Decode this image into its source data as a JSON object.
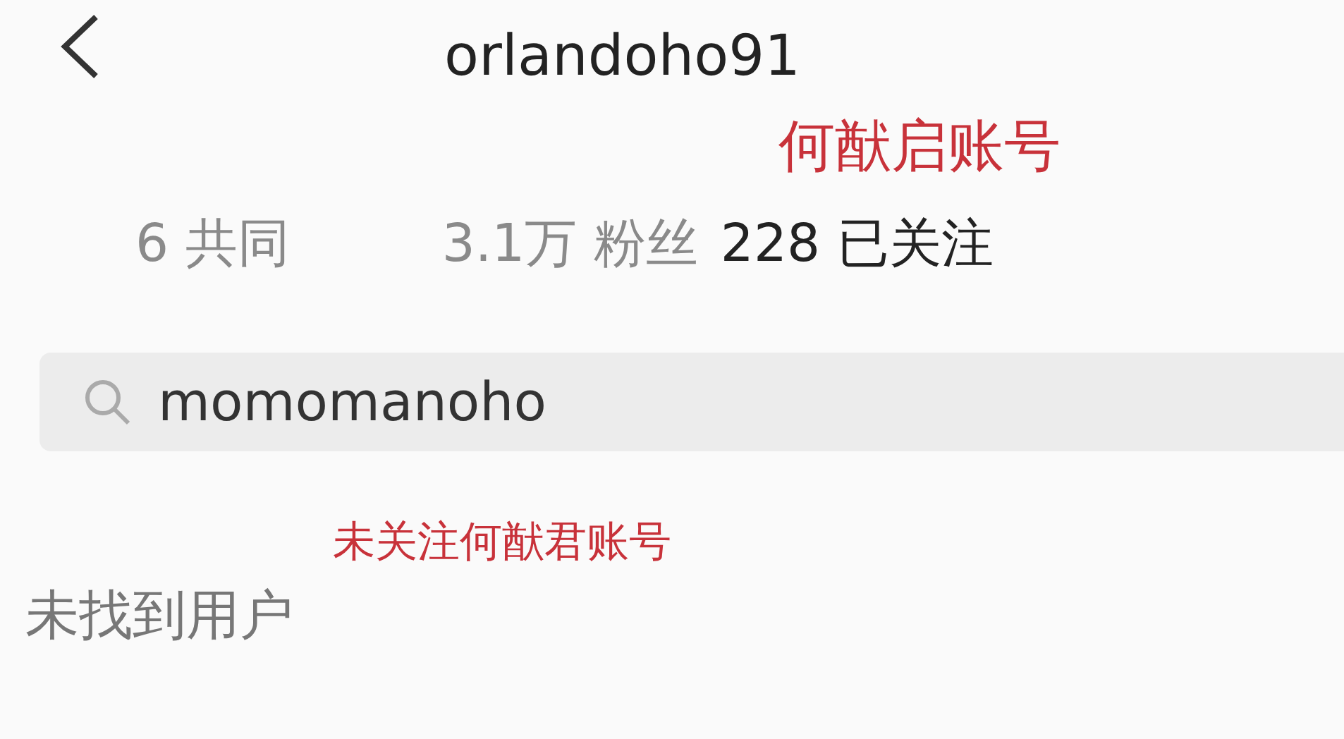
{
  "header": {
    "title": "orlandoho91"
  },
  "annotations": [
    {
      "text": "何猷启账号"
    },
    {
      "text": "未关注何猷君账号"
    }
  ],
  "tabs": [
    {
      "label": "6 共同",
      "selected": false
    },
    {
      "label": "3.1万 粉丝",
      "selected": false
    },
    {
      "label": "228 已关注",
      "selected": true
    }
  ],
  "search": {
    "value": "momomanoho"
  },
  "empty_message": "未找到用户"
}
